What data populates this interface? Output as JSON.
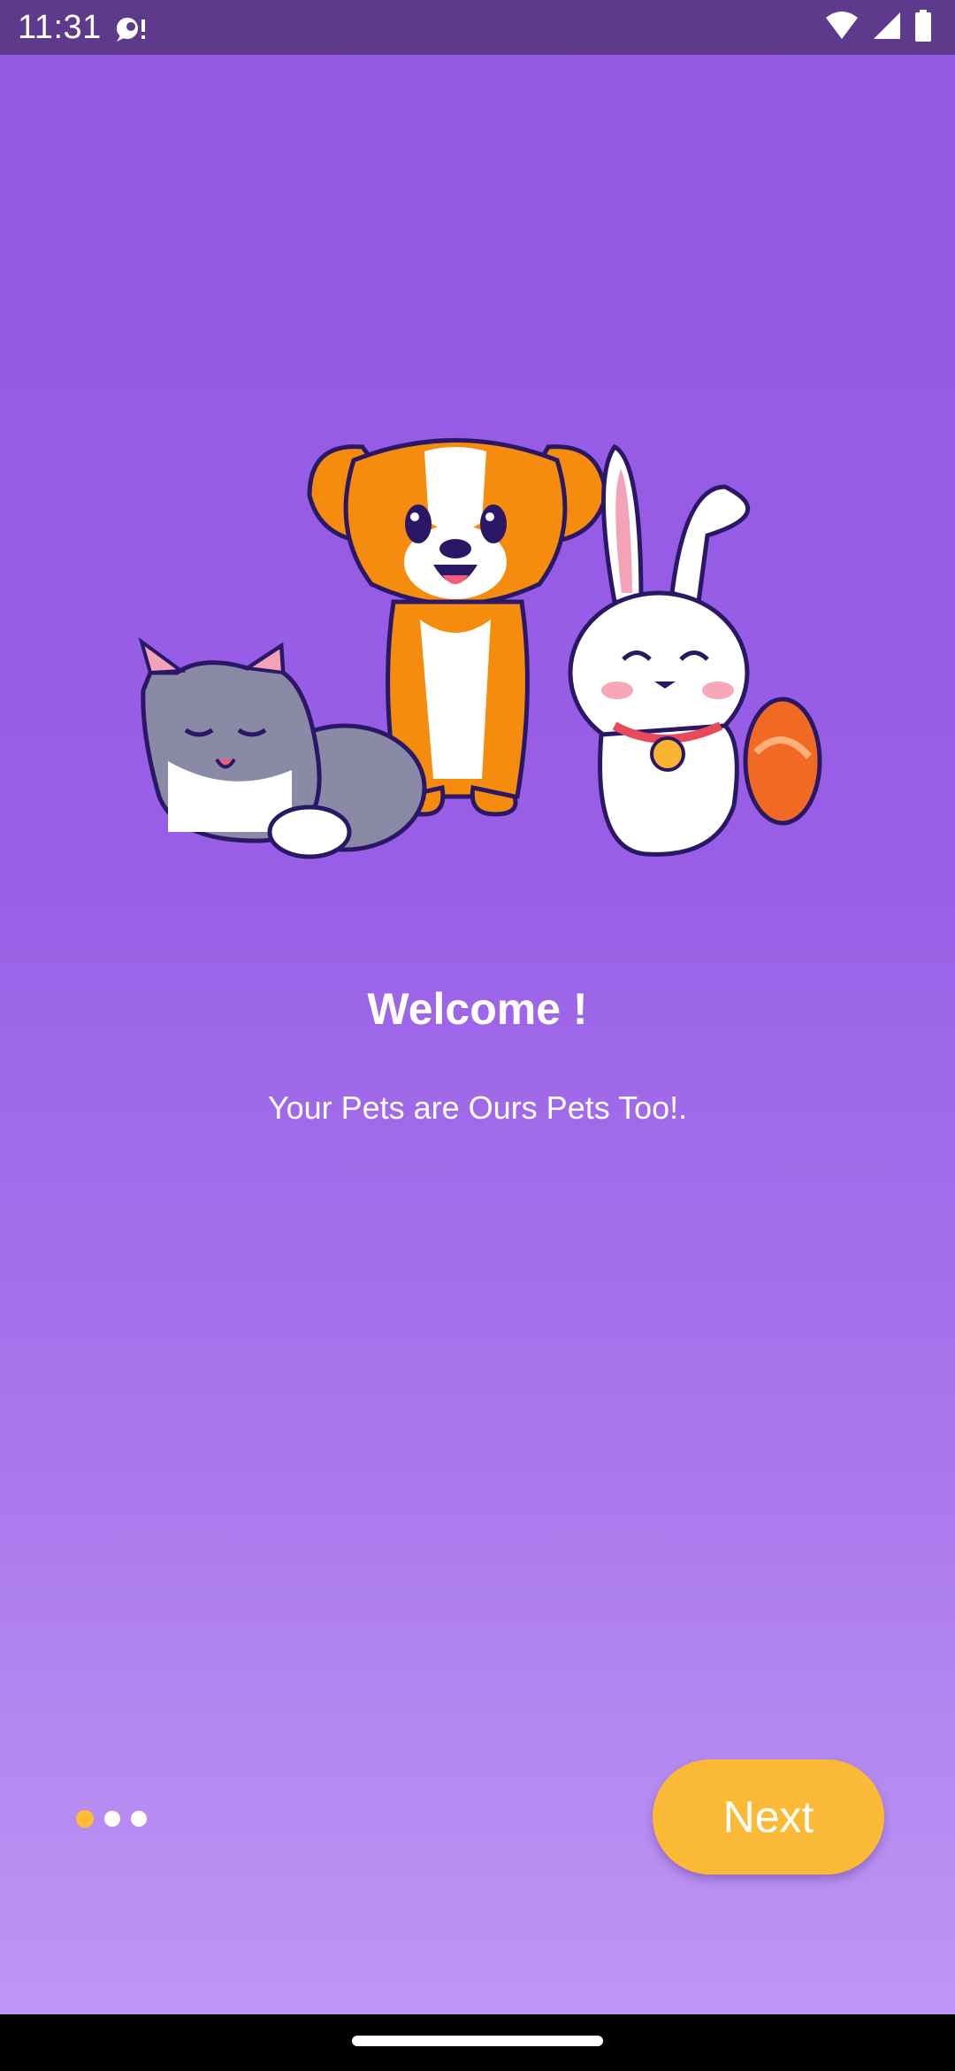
{
  "status_bar": {
    "time": "11:31",
    "left_icon": "notification-icon",
    "right_icons": [
      "wifi-icon",
      "cellular-signal-icon",
      "battery-icon"
    ]
  },
  "illustration": {
    "icon": "pets-illustration",
    "animals": [
      "cat",
      "dog",
      "rabbit"
    ]
  },
  "onboarding": {
    "title": "Welcome !",
    "subtitle": "Your Pets are Ours Pets Too!.",
    "page_count": 3,
    "current_page": 1,
    "next_label": "Next"
  },
  "colors": {
    "background_top": "#9559e4",
    "background_bottom": "#c09af6",
    "accent": "#fbba35",
    "status_bar": "#5d3a8c",
    "text": "#ffffff"
  }
}
